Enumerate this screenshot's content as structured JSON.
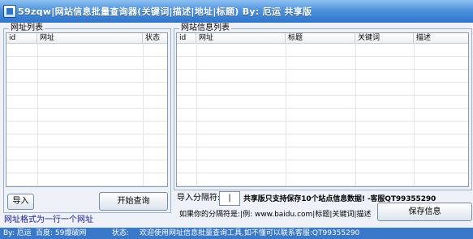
{
  "window": {
    "title": "59zqw|网站信息批量查询器(关键词|描述|地址|标题)  By: 厄运   共享版"
  },
  "url_list": {
    "label": "网址列表",
    "columns": [
      "id",
      "网址",
      "状态"
    ],
    "import_button": "导入",
    "start_button": "开始查询",
    "format_hint": "网址格式为一行一个网址"
  },
  "info_list": {
    "label": "网站信息列表",
    "columns": [
      "id",
      "网址",
      "标题",
      "关键词",
      "描述"
    ],
    "separator_label": "导入分隔符:",
    "separator_value": "|",
    "notice": "共享版只支持保存10个站点信息数据! -客服QT99355290",
    "example_label": "如果你的分隔符是:|例: www.baidu.com|标题|关键词|描述",
    "save_button": "保存信息"
  },
  "statusbar": {
    "author": "By: 厄运",
    "baidu_label": "百度: 59爆破网",
    "status_label": "状态:",
    "status_text": "欢迎使用网址信息批量查询工具,如不懂可以联系客服:QT99355290"
  }
}
